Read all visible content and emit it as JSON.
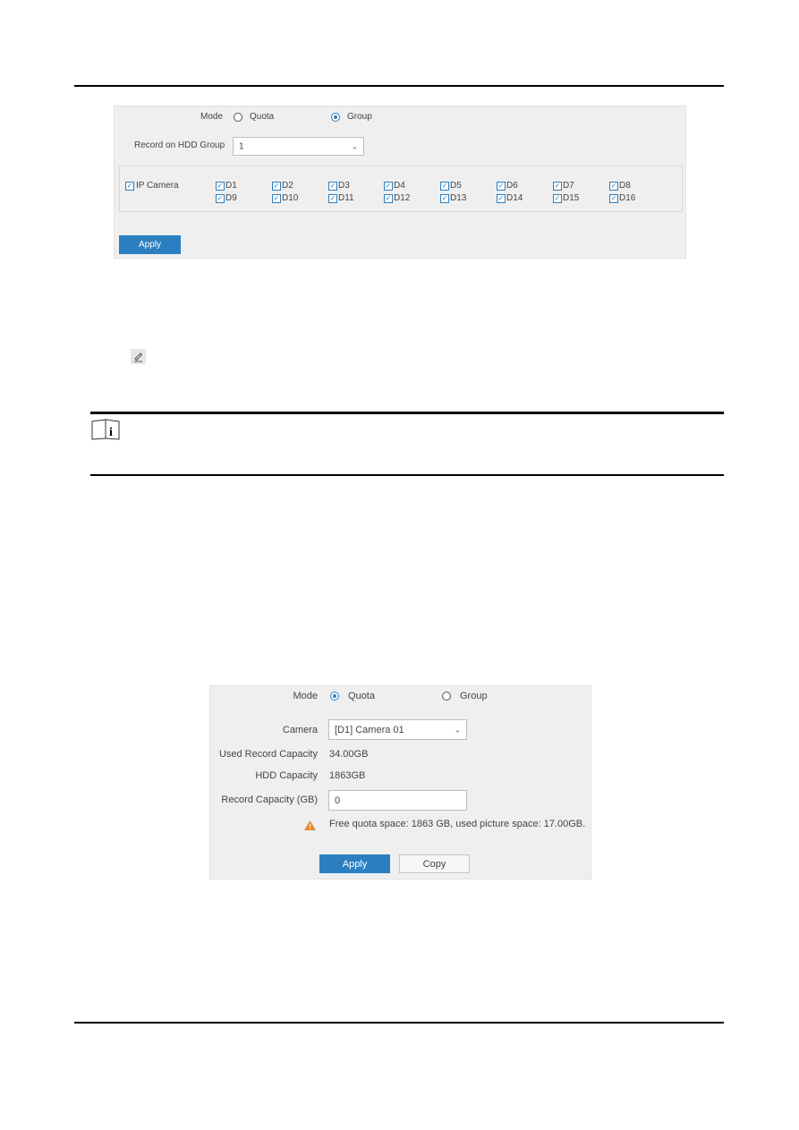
{
  "screenshot_group": {
    "mode_label": "Mode",
    "mode_options": [
      "Quota",
      "Group"
    ],
    "mode_selected": "Group",
    "hdd_group_label": "Record on HDD Group",
    "hdd_group_value": "1",
    "ip_camera_label": "IP Camera",
    "cameras": [
      "D1",
      "D2",
      "D3",
      "D4",
      "D5",
      "D6",
      "D7",
      "D8",
      "D9",
      "D10",
      "D11",
      "D12",
      "D13",
      "D14",
      "D15",
      "D16"
    ],
    "apply_label": "Apply"
  },
  "screenshot_quota": {
    "mode_label": "Mode",
    "mode_options": [
      "Quota",
      "Group"
    ],
    "mode_selected": "Quota",
    "camera_label": "Camera",
    "camera_value": "[D1] Camera 01",
    "used_record_capacity_label": "Used Record Capacity",
    "used_record_capacity_value": "34.00GB",
    "hdd_capacity_label": "HDD Capacity",
    "hdd_capacity_value": "1863GB",
    "record_capacity_label": "Record Capacity (GB)",
    "record_capacity_value": "0",
    "warning_text": "Free quota space: 1863 GB, used picture space: 17.00GB.",
    "apply_label": "Apply",
    "copy_label": "Copy"
  },
  "icons": {
    "edit": "pencil-icon",
    "note": "note-book-icon",
    "warning": "warning-triangle-icon"
  },
  "colors": {
    "accent": "#2b7fc0",
    "warning": "#e8882a"
  }
}
